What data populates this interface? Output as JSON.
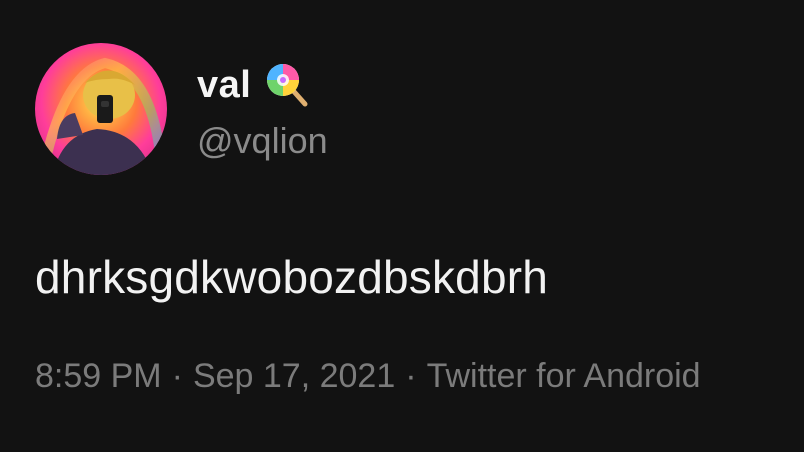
{
  "author": {
    "display_name": "val",
    "handle": "@vqlion",
    "name_emoji_icon": "lollipop-icon",
    "avatar_icon": "avatar-photo"
  },
  "tweet": {
    "text": "dhrksgdkwobozdbskdbrh",
    "time": "8:59 PM",
    "date": "Sep 17, 2021",
    "source": "Twitter for Android",
    "separator": "·"
  },
  "colors": {
    "background": "#121212",
    "text": "#f2f2f2",
    "muted": "#7b7b7b"
  }
}
